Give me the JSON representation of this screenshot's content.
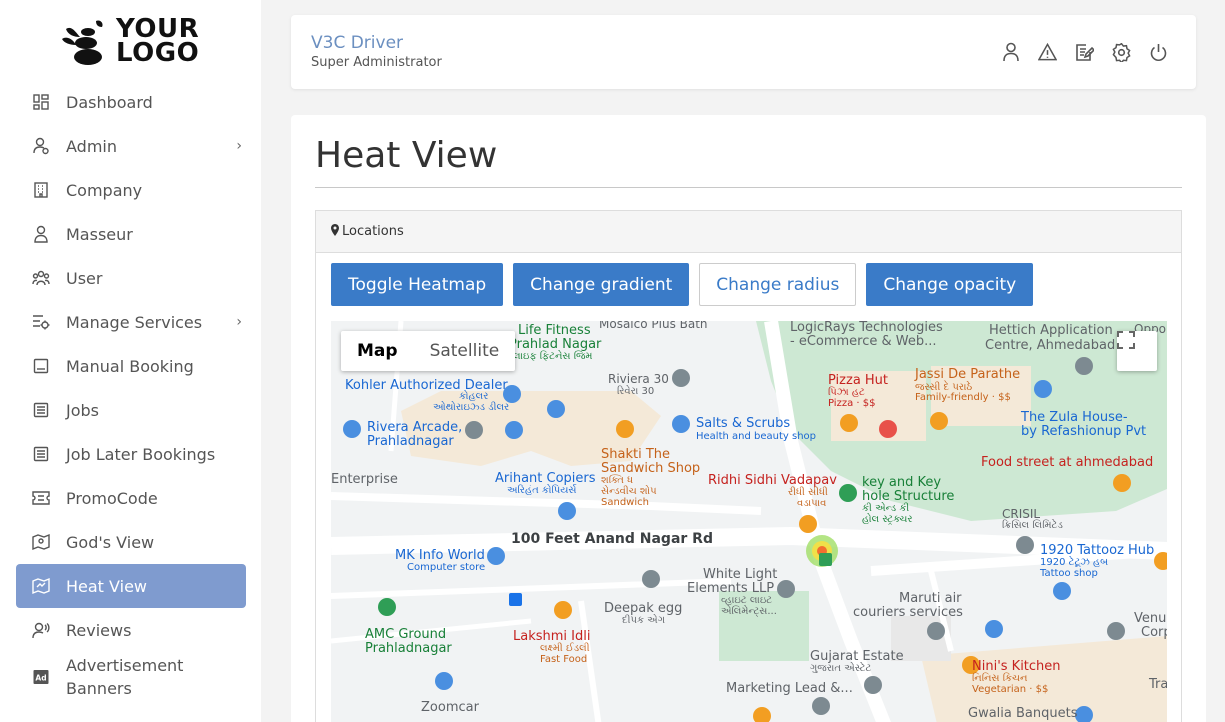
{
  "logo": {
    "line1": "YOUR",
    "line2": "LOGO"
  },
  "sidebar": {
    "items": [
      {
        "label": "Dashboard",
        "icon": "dashboard-icon"
      },
      {
        "label": "Admin",
        "icon": "admin-user-icon",
        "chevron": "›"
      },
      {
        "label": "Company",
        "icon": "building-icon"
      },
      {
        "label": "Masseur",
        "icon": "person-icon"
      },
      {
        "label": "User",
        "icon": "users-icon"
      },
      {
        "label": "Manage Services",
        "icon": "services-icon",
        "chevron": "›"
      },
      {
        "label": "Manual Booking",
        "icon": "booking-icon"
      },
      {
        "label": "Jobs",
        "icon": "document-icon"
      },
      {
        "label": "Job Later Bookings",
        "icon": "document-icon"
      },
      {
        "label": "PromoCode",
        "icon": "ticket-icon"
      },
      {
        "label": "God's View",
        "icon": "map-pin-icon"
      },
      {
        "label": "Heat View",
        "icon": "heat-map-icon"
      },
      {
        "label": "Reviews",
        "icon": "reviews-icon"
      },
      {
        "label": "Advertisement Banners",
        "icon": "ad-icon"
      }
    ],
    "active": "Heat View"
  },
  "header": {
    "title": "V3C Driver",
    "subtitle": "Super Administrator",
    "icons": [
      "profile-icon",
      "alert-icon",
      "edit-icon",
      "settings-icon",
      "power-icon"
    ]
  },
  "main": {
    "title": "Heat View",
    "panel_title": "Locations",
    "buttons": [
      "Toggle Heatmap",
      "Change gradient",
      "Change radius",
      "Change opacity"
    ],
    "map": {
      "type_controls": [
        "Map",
        "Satellite"
      ],
      "selected_type": "Map",
      "labels": {
        "life_fitness": "Life Fitness",
        "prahlad_nagar": "Prahlad Nagar",
        "life_fitness_gu": "લાઇફ ફિટનેસ જિમ",
        "mosaico": "Mosaico Plus Bath",
        "logicrays": "LogicRays Technologies",
        "logicrays2": "- eCommerce & Web...",
        "hettich": "Hettich Application",
        "hettich2": "Centre, Ahmedabad",
        "oppo": "Oppo s",
        "riviera": "Riviera 30",
        "riviera_gu": "રિવેરા 30",
        "kohler": "Kohler Authorized Dealer",
        "kohler_gu": "કોહલર",
        "kohler_gu2": "ઓથોરાઇઝ્ડ ડીલર",
        "pizza_hut": "Pizza Hut",
        "pizza_hut_gu": "પિઝા હટ",
        "pizza_hut_sub": "Pizza · $$",
        "jassi": "Jassi De Parathe",
        "jassi_gu": "જસ્સી દે પરાઠે",
        "jassi_sub": "Family-friendly · $$",
        "rivera_arcade": "Rivera Arcade,",
        "rivera_arcade2": "Prahladnagar",
        "salts": "Salts & Scrubs",
        "salts_sub": "Health and beauty shop",
        "zula": "The Zula House-",
        "zula2": "by Refashionup Pvt",
        "shakti": "Shakti The",
        "shakti2": "Sandwich Shop",
        "shakti_gu": "શક્તિ ધ",
        "shakti_gu2": "સેન્ડવીચ શોપ",
        "shakti_sub": "Sandwich",
        "food_street": "Food street at ahmedabad",
        "enterprise": "Enterprise",
        "arihant": "Arihant Copiers",
        "arihant_gu": "અરિહંત કોપિયર્સ",
        "ridhi": "Ridhi Sidhi Vadapav",
        "ridhi_gu": "રીધી સીધી",
        "ridhi_gu2": "વડાપાવ",
        "key": "key and Key",
        "key2": "hole Structure",
        "key_gu": "કી એન્ડ કી",
        "key_gu2": "હોલ સ્ટ્રક્ચર",
        "crisil": "CRISIL",
        "crisil_gu": "ક્રિસિલ લિમિટેડ",
        "road": "100 Feet Anand Nagar Rd",
        "mk_info": "MK Info World",
        "mk_sub": "Computer store",
        "tattooz": "1920 Tattooz Hub",
        "tattooz_gu": "1920 ટેટૂઝ હબ",
        "tattooz_sub": "Tattoo shop",
        "white_light": "White Light",
        "white_light2": "Elements LLP",
        "white_light_gu": "વ્હાઇટ લાઇટ",
        "white_light_gu2": "એલિમેન્ટ્સ...",
        "deepak": "Deepak egg",
        "deepak_gu": "દીપક એગ",
        "maruti": "Maruti air",
        "maruti2": "couriers services",
        "venus": "Venus",
        "venus2": "Corpo",
        "amc": "AMC Ground",
        "amc2": "Prahladnagar",
        "lakshmi": "Lakshmi Idli",
        "lakshmi_gu": "લક્ષ્મી ઈડલી",
        "lakshmi_sub": "Fast Food",
        "gujarat_estate": "Gujarat Estate",
        "gujarat_estate_gu": "ગુજરાત એસ્ટેટ",
        "ninis": "Nini's Kitchen",
        "ninis_gu": "નિનિસ કિચન",
        "ninis_sub": "Vegetarian · $$",
        "marketing": "Marketing Lead &...",
        "zoomcar": "Zoomcar",
        "gwalia": "Gwalia Banquets",
        "tra": "Tra"
      }
    }
  },
  "colors": {
    "accent": "#7f9bcf",
    "button": "#3a7bc8",
    "header_title": "#6b8fc0"
  }
}
